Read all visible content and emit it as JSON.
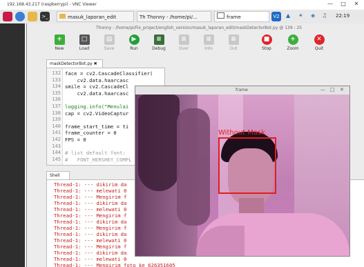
{
  "vnc": {
    "title": "192.168.43.217 (raspberrypi) - VNC Viewer",
    "controls": [
      "—",
      "□",
      "✕"
    ]
  },
  "taskbar": {
    "tasks": [
      {
        "label": "masuk_laporan_edit"
      },
      {
        "label": "Thonny - /home/pi/..."
      },
      {
        "label": "frame"
      }
    ],
    "clock": "22:19"
  },
  "thonny": {
    "title": "Thonny - /home/pi/Fix_project/english_version/masuk_laporan_edit/maskDetectorBot.py @ 139 : 25",
    "toolbar": [
      {
        "label": "New",
        "icon": "plus-icon",
        "color": "#3cae3c",
        "enabled": true
      },
      {
        "label": "Load",
        "icon": "folder-icon",
        "color": "#555555",
        "enabled": true
      },
      {
        "label": "Save",
        "icon": "save-icon",
        "color": "#888888",
        "enabled": false
      },
      {
        "label": "Run",
        "icon": "play-icon",
        "color": "#22a03a",
        "enabled": true
      },
      {
        "label": "Debug",
        "icon": "bug-icon",
        "color": "#3a6e3a",
        "enabled": true
      },
      {
        "label": "Over",
        "icon": "step-over-icon",
        "color": "#888888",
        "enabled": false
      },
      {
        "label": "Into",
        "icon": "step-into-icon",
        "color": "#888888",
        "enabled": false
      },
      {
        "label": "Out",
        "icon": "step-out-icon",
        "color": "#888888",
        "enabled": false
      },
      {
        "label": "Stop",
        "icon": "stop-icon",
        "color": "#e0242c",
        "enabled": true
      },
      {
        "label": "Zoom",
        "icon": "zoom-icon",
        "color": "#3cae3c",
        "enabled": true
      },
      {
        "label": "Quit",
        "icon": "quit-icon",
        "color": "#e0242c",
        "enabled": true
      }
    ],
    "editor_tab": "maskDetectorBot.py ✖",
    "shell_tab": "Shell",
    "code": [
      {
        "n": "132",
        "text": "face = cv2.CascadeClassifier(",
        "kind": "code"
      },
      {
        "n": "133",
        "text": "    cv2.data.haarcasc",
        "kind": "code"
      },
      {
        "n": "134",
        "text": "smile = cv2.CascadeCl",
        "kind": "code"
      },
      {
        "n": "135",
        "text": "    cv2.data.haarcasc",
        "kind": "code"
      },
      {
        "n": "136",
        "text": "",
        "kind": "code"
      },
      {
        "n": "137",
        "text": "logging.info(\"Menulai",
        "kind": "str"
      },
      {
        "n": "138",
        "text": "cap = cv2.VideoCaptur",
        "kind": "code"
      },
      {
        "n": "139",
        "text": "",
        "kind": "code"
      },
      {
        "n": "140",
        "text": "frame_start_time = ti",
        "kind": "code"
      },
      {
        "n": "141",
        "text": "frame_counter = 0",
        "kind": "code"
      },
      {
        "n": "142",
        "text": "FPS = 0",
        "kind": "code"
      },
      {
        "n": "143",
        "text": "",
        "kind": "code"
      },
      {
        "n": "144",
        "text": "# list default font:",
        "kind": "cmt"
      },
      {
        "n": "145",
        "text": "#   FONT_HERSHEY_COMPL",
        "kind": "cmt"
      }
    ],
    "shell_lines": [
      "Thread-1: --- dikirim da",
      "Thread-1: --- melewati 0",
      "Thread-1: --- Mengirim f",
      "Thread-1: --- dikirim da",
      "Thread-1: --- melewati 0",
      "Thread-1: --- Mengirim f",
      "Thread-1: --- dikirim da",
      "Thread-1: --- Mengirim f",
      "Thread-1: --- dikirim da",
      "Thread-1: --- melewati 0",
      "Thread-1: --- Mengirim f",
      "Thread-1: --- dikirim da",
      "Thread-1: --- melewati 0",
      "Thread-1: --- Mengirim foto ke 626351605"
    ]
  },
  "frame": {
    "title": "frame",
    "controls": [
      "—",
      "□",
      "✕"
    ],
    "detection_label": "Without Mask",
    "box_color": "#e01e1e"
  }
}
